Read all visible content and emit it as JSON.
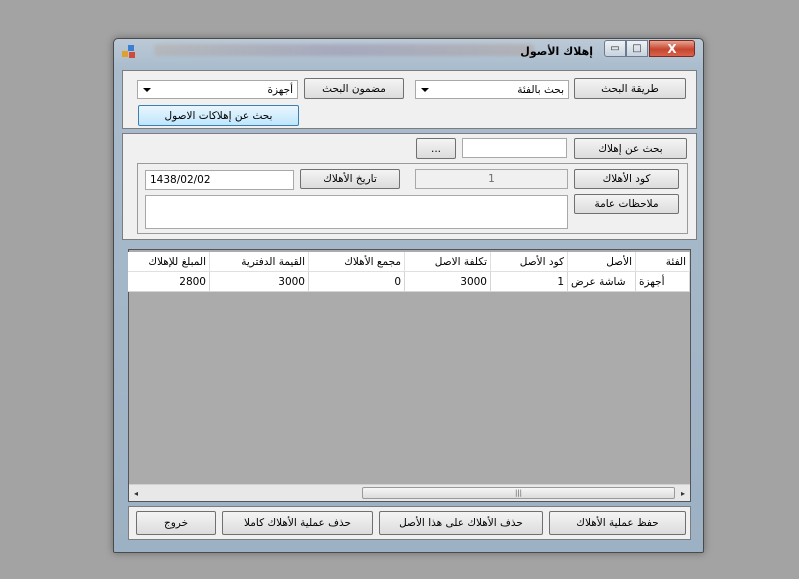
{
  "window": {
    "title": "إهلاك الأصول",
    "close_glyph": "X",
    "max_glyph": "□",
    "min_glyph": "▭"
  },
  "search": {
    "method_label": "طريقة البحث",
    "method_value": "بحث بالفئة",
    "content_label": "مضمون البحث",
    "content_value": "أجهزة",
    "search_button": "بحث عن إهلاكات الاصول"
  },
  "depreciation": {
    "search_label": "بحث عن إهلاك",
    "browse_button": "...",
    "code_label": "كود الأهلاك",
    "code_value": "1",
    "date_label": "تاريخ الأهلاك",
    "date_value": "1438/02/02",
    "notes_label": "ملاحظات عامة",
    "notes_value": ""
  },
  "table": {
    "columns": [
      "الفئة",
      "الأصل",
      "كود الأصل",
      "تكلفة الاصل",
      "مجمع الأهلاك",
      "القيمة الدفترية",
      "المبلغ للإهلاك"
    ],
    "rows": [
      [
        "أجهزة",
        "شاشة عرض",
        "1",
        "3000",
        "0",
        "3000",
        "2800"
      ]
    ],
    "scroll_left": "◂",
    "scroll_right": "▸",
    "scroll_grip": "|||"
  },
  "actions": {
    "save": "حفظ عملية الأهلاك",
    "delete_asset": "حذف الأهلاك على هذا الأصل",
    "delete_all": "حذف عملية الأهلاك كاملا",
    "exit": "خروج"
  },
  "colors": {
    "close_button": "#c7462f",
    "selected_button": "#bee6fd",
    "grid_background": "#ababab"
  }
}
